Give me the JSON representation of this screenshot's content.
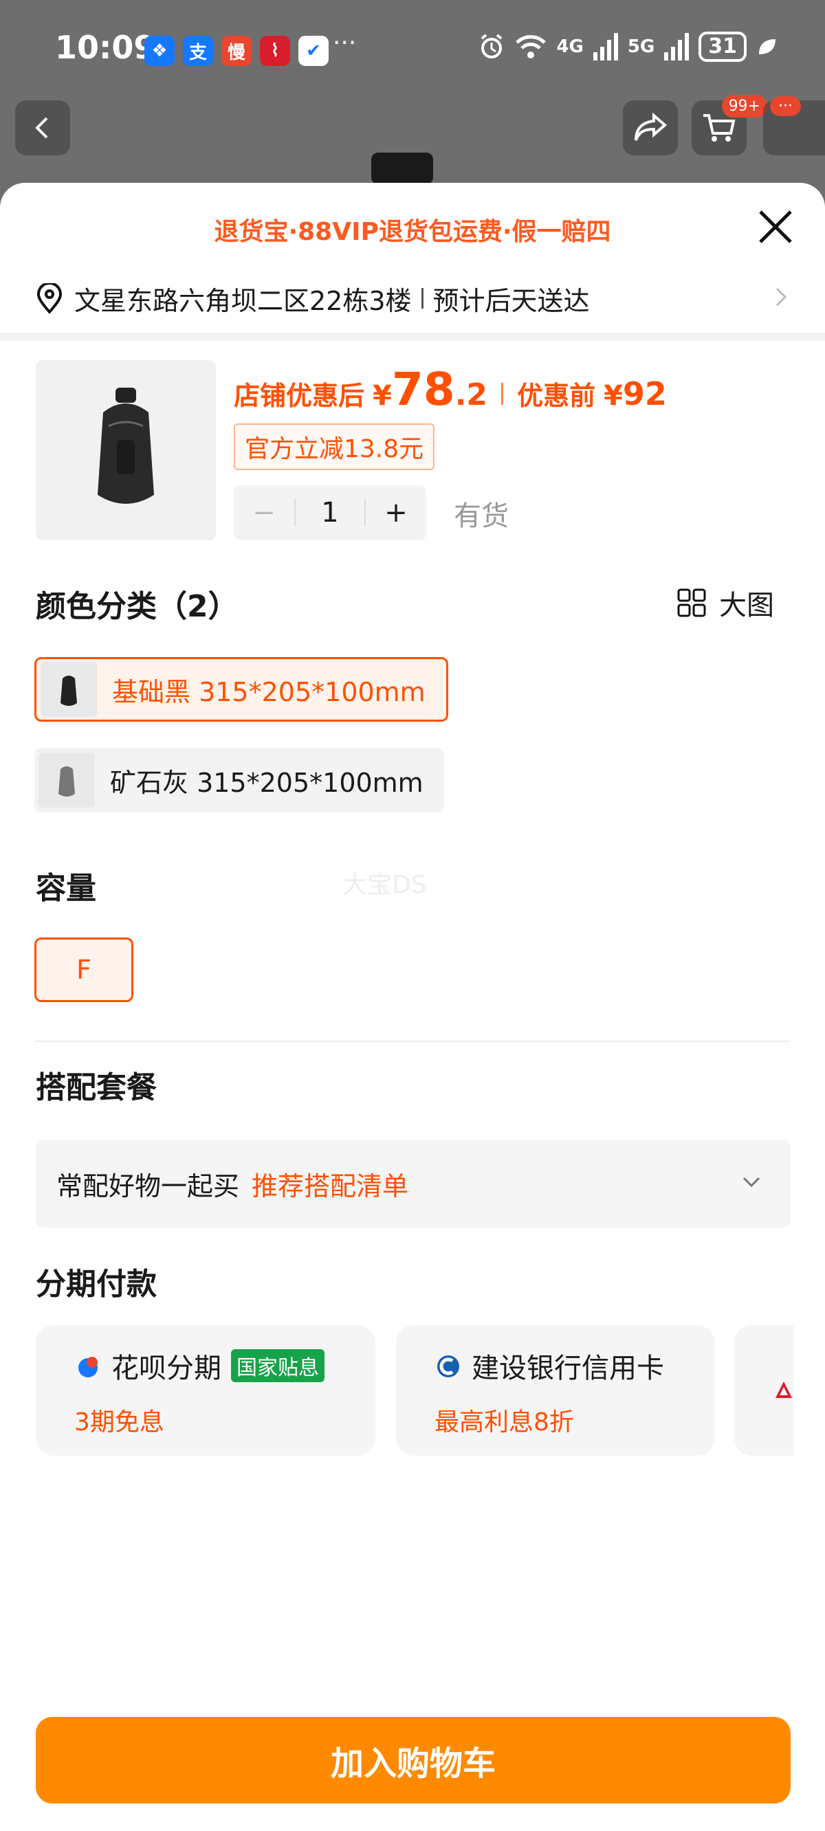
{
  "status_bar": {
    "time": "10:09",
    "more_dots": "···",
    "network_4g": "4G",
    "network_5g": "5G",
    "battery": "31",
    "app_icons": [
      "alipay-blue-icon",
      "alipay-zhi-icon",
      "man-app-icon",
      "chart-app-icon",
      "check-app-icon"
    ],
    "app_icon_chars": [
      "❖",
      "支",
      "慢",
      "⌇",
      "✔"
    ]
  },
  "top_nav": {
    "cart_badge": "99+",
    "more_badge": "···"
  },
  "sheet": {
    "banner": "退货宝·88VIP退货包运费·假一赔四",
    "address": "文星东路六角坝二区22栋3楼",
    "delivery": "预计后天送达"
  },
  "product": {
    "price_label": "店铺优惠后",
    "currency": "¥",
    "price_int": "78",
    "price_dec": ".2",
    "orig_label": "优惠前",
    "orig_price": "92",
    "coupon": "官方立减13.8元",
    "minus": "−",
    "quantity": "1",
    "plus": "+",
    "stock": "有货"
  },
  "color_section": {
    "title": "颜色分类（2）",
    "big_view": "大图",
    "options": [
      {
        "label": "基础黑 315*205*100mm",
        "selected": true
      },
      {
        "label": "矿石灰 315*205*100mm",
        "selected": false
      }
    ]
  },
  "capacity_section": {
    "title": "容量",
    "option": "F"
  },
  "watermark": "大宝DS",
  "bundle_section": {
    "title": "搭配套餐",
    "text": "常配好物一起买",
    "link": "推荐搭配清单"
  },
  "installment_section": {
    "title": "分期付款",
    "cards": [
      {
        "title": "花呗分期",
        "badge": "国家贴息",
        "sub": "3期免息"
      },
      {
        "title": "建设银行信用卡",
        "sub": "最高利息8折"
      }
    ]
  },
  "cta": "加入购物车",
  "colors": {
    "accent": "#ff5000",
    "cta": "#ff8a00",
    "badge_green": "#18a34a"
  }
}
